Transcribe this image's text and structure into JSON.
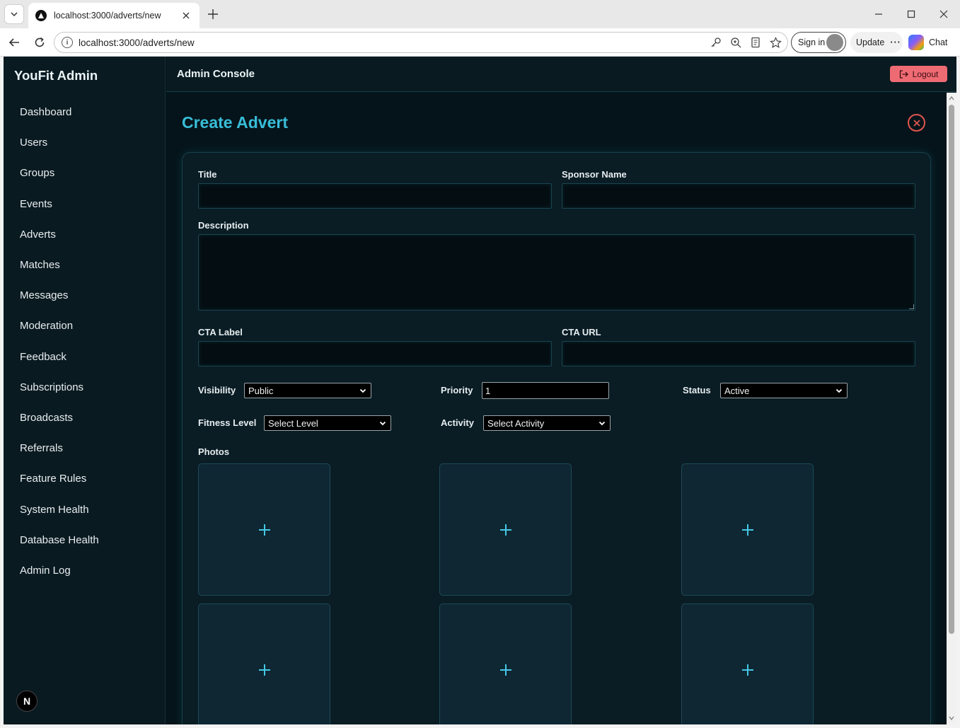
{
  "browser": {
    "tab_title": "localhost:3000/adverts/new",
    "url": "localhost:3000/adverts/new",
    "signin_label": "Sign in",
    "update_label": "Update",
    "chat_label": "Chat"
  },
  "sidebar": {
    "brand": "YouFit Admin",
    "items": [
      {
        "label": "Dashboard"
      },
      {
        "label": "Users"
      },
      {
        "label": "Groups"
      },
      {
        "label": "Events"
      },
      {
        "label": "Adverts"
      },
      {
        "label": "Matches"
      },
      {
        "label": "Messages"
      },
      {
        "label": "Moderation"
      },
      {
        "label": "Feedback"
      },
      {
        "label": "Subscriptions"
      },
      {
        "label": "Broadcasts"
      },
      {
        "label": "Referrals"
      },
      {
        "label": "Feature Rules"
      },
      {
        "label": "System Health"
      },
      {
        "label": "Database Health"
      },
      {
        "label": "Admin Log"
      }
    ],
    "badge": "N"
  },
  "topbar": {
    "title": "Admin Console",
    "logout_label": "Logout"
  },
  "form": {
    "page_title": "Create Advert",
    "title_label": "Title",
    "title_value": "",
    "sponsor_label": "Sponsor Name",
    "sponsor_value": "",
    "description_label": "Description",
    "description_value": "",
    "cta_label_label": "CTA Label",
    "cta_label_value": "",
    "cta_url_label": "CTA URL",
    "cta_url_value": "",
    "visibility_label": "Visibility",
    "visibility_value": "Public",
    "priority_label": "Priority",
    "priority_value": "1",
    "status_label": "Status",
    "status_value": "Active",
    "fitness_label": "Fitness Level",
    "fitness_value": "Select Level",
    "activity_label": "Activity",
    "activity_value": "Select Activity",
    "photos_label": "Photos",
    "photo_slot_count": 6
  },
  "colors": {
    "accent": "#38bdd8",
    "danger": "#ef6b74",
    "background": "#05141a",
    "sidebar": "#0a1a21"
  }
}
